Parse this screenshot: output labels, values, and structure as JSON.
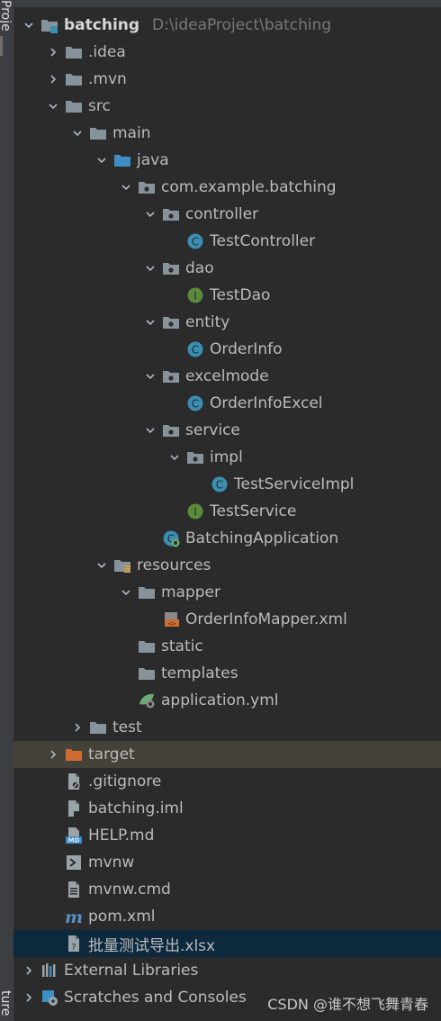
{
  "sidebar": {
    "top_label": "Proje",
    "bottom_label": "ture"
  },
  "colors": {
    "background": "#2b2b2b",
    "folder": "#87939a",
    "source_folder": "#3d8ec4",
    "excluded_folder": "#cf6b33",
    "class_badge": "#3b8eb1",
    "interface_badge": "#5a8a3a",
    "selection": "#0d293e"
  },
  "tree": [
    {
      "label": "batching",
      "path": "D:\\ideaProject\\batching",
      "bold": true,
      "icon": "module-folder-icon",
      "chevron": "down",
      "indent": 0
    },
    {
      "label": ".idea",
      "icon": "folder-icon",
      "chevron": "right",
      "indent": 1
    },
    {
      "label": ".mvn",
      "icon": "folder-icon",
      "chevron": "right",
      "indent": 1
    },
    {
      "label": "src",
      "icon": "folder-icon",
      "chevron": "down",
      "indent": 1
    },
    {
      "label": "main",
      "icon": "folder-icon",
      "chevron": "down",
      "indent": 2
    },
    {
      "label": "java",
      "icon": "source-folder-icon",
      "chevron": "down",
      "indent": 3
    },
    {
      "label": "com.example.batching",
      "icon": "package-icon",
      "chevron": "down",
      "indent": 4
    },
    {
      "label": "controller",
      "icon": "package-icon",
      "chevron": "down",
      "indent": 5
    },
    {
      "label": "TestController",
      "icon": "class-icon",
      "chevron": "none",
      "indent": 6
    },
    {
      "label": "dao",
      "icon": "package-icon",
      "chevron": "down",
      "indent": 5
    },
    {
      "label": "TestDao",
      "icon": "interface-icon",
      "chevron": "none",
      "indent": 6
    },
    {
      "label": "entity",
      "icon": "package-icon",
      "chevron": "down",
      "indent": 5
    },
    {
      "label": "OrderInfo",
      "icon": "class-icon",
      "chevron": "none",
      "indent": 6
    },
    {
      "label": "excelmode",
      "icon": "package-icon",
      "chevron": "down",
      "indent": 5
    },
    {
      "label": "OrderInfoExcel",
      "icon": "class-icon",
      "chevron": "none",
      "indent": 6
    },
    {
      "label": "service",
      "icon": "package-icon",
      "chevron": "down",
      "indent": 5
    },
    {
      "label": "impl",
      "icon": "package-icon",
      "chevron": "down",
      "indent": 6
    },
    {
      "label": "TestServiceImpl",
      "icon": "class-icon",
      "chevron": "none",
      "indent": 7
    },
    {
      "label": "TestService",
      "icon": "interface-icon",
      "chevron": "none",
      "indent": 6
    },
    {
      "label": "BatchingApplication",
      "icon": "spring-boot-class-icon",
      "chevron": "none",
      "indent": 5
    },
    {
      "label": "resources",
      "icon": "resources-folder-icon",
      "chevron": "down",
      "indent": 3
    },
    {
      "label": "mapper",
      "icon": "folder-icon",
      "chevron": "down",
      "indent": 4
    },
    {
      "label": "OrderInfoMapper.xml",
      "icon": "xml-file-icon",
      "chevron": "none",
      "indent": 5
    },
    {
      "label": "static",
      "icon": "folder-icon",
      "chevron": "none",
      "indent": 4
    },
    {
      "label": "templates",
      "icon": "folder-icon",
      "chevron": "none",
      "indent": 4
    },
    {
      "label": "application.yml",
      "icon": "spring-yml-icon",
      "chevron": "none",
      "indent": 4
    },
    {
      "label": "test",
      "icon": "folder-icon",
      "chevron": "right",
      "indent": 2
    },
    {
      "label": "target",
      "icon": "excluded-folder-icon",
      "chevron": "right",
      "indent": 1,
      "state": "highlighted"
    },
    {
      "label": ".gitignore",
      "icon": "ignore-file-icon",
      "chevron": "none",
      "indent": 1
    },
    {
      "label": "batching.iml",
      "icon": "iml-file-icon",
      "chevron": "none",
      "indent": 1
    },
    {
      "label": "HELP.md",
      "icon": "markdown-file-icon",
      "chevron": "none",
      "indent": 1
    },
    {
      "label": "mvnw",
      "icon": "shell-file-icon",
      "chevron": "none",
      "indent": 1
    },
    {
      "label": "mvnw.cmd",
      "icon": "text-file-icon",
      "chevron": "none",
      "indent": 1
    },
    {
      "label": "pom.xml",
      "icon": "maven-icon",
      "chevron": "none",
      "indent": 1
    },
    {
      "label": "批量测试导出.xlsx",
      "icon": "unknown-file-icon",
      "chevron": "none",
      "indent": 1,
      "state": "selected"
    },
    {
      "label": "External Libraries",
      "icon": "libraries-icon",
      "chevron": "right",
      "indent": 0
    },
    {
      "label": "Scratches and Consoles",
      "icon": "scratches-icon",
      "chevron": "right",
      "indent": 0
    }
  ],
  "watermark": "CSDN @谁不想飞舞青春"
}
